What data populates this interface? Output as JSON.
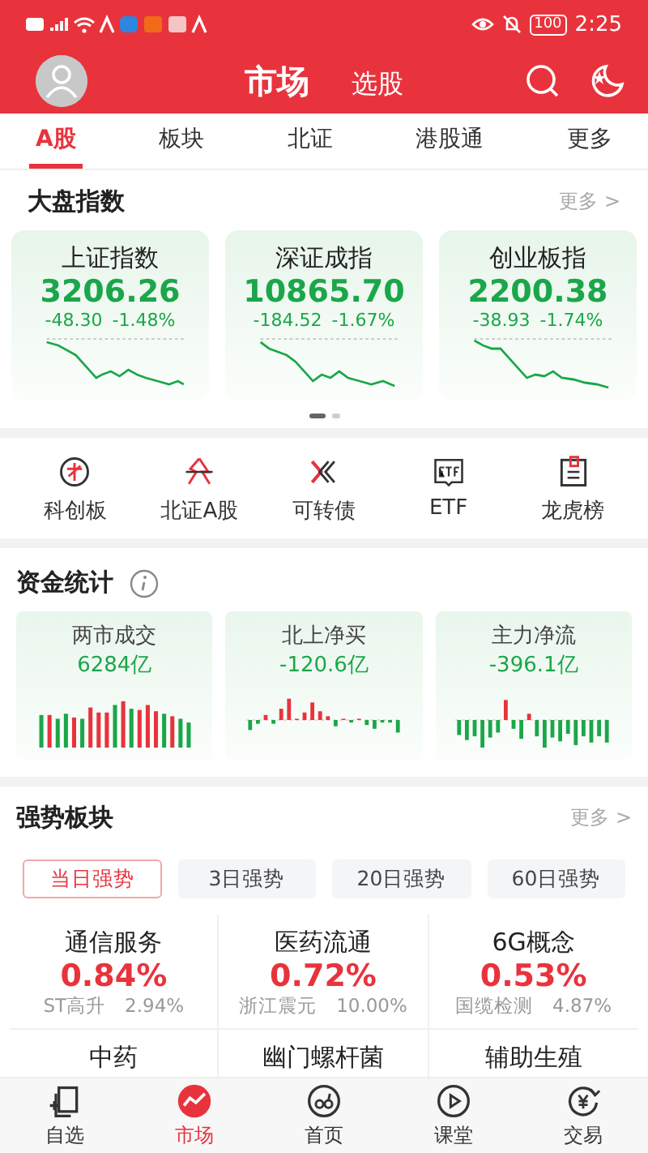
{
  "status_bar": {
    "battery": "100",
    "time": "2:25"
  },
  "header": {
    "title": "市场",
    "secondary": "选股"
  },
  "tabs": [
    {
      "label": "A股",
      "selected": true
    },
    {
      "label": "板块",
      "selected": false
    },
    {
      "label": "北证",
      "selected": false
    },
    {
      "label": "港股通",
      "selected": false
    },
    {
      "label": "更多",
      "selected": false
    }
  ],
  "indices": {
    "title": "大盘指数",
    "more": "更多 >",
    "cards": [
      {
        "name": "上证指数",
        "value": "3206.26",
        "change": "-48.30",
        "pct": "-1.48%"
      },
      {
        "name": "深证成指",
        "value": "10865.70",
        "change": "-184.52",
        "pct": "-1.67%"
      },
      {
        "name": "创业板指",
        "value": "2200.38",
        "change": "-38.93",
        "pct": "-1.74%"
      }
    ],
    "pages": [
      {
        "selected": true
      },
      {
        "selected": false
      }
    ]
  },
  "shortcuts": [
    {
      "label": "科创板",
      "kind": "ke"
    },
    {
      "label": "北证A股",
      "kind": "bei"
    },
    {
      "label": "可转债",
      "kind": "bond"
    },
    {
      "label": "ETF",
      "kind": "etf"
    },
    {
      "label": "龙虎榜",
      "kind": "board"
    }
  ],
  "funds": {
    "title": "资金统计",
    "cards": [
      {
        "name": "两市成交",
        "value": "6284亿",
        "kind": "volume"
      },
      {
        "name": "北上净买",
        "value": "-120.6亿",
        "kind": "north"
      },
      {
        "name": "主力净流",
        "value": "-396.1亿",
        "kind": "main"
      }
    ]
  },
  "strong": {
    "title": "强势板块",
    "more": "更多 >",
    "periods": [
      {
        "label": "当日强势",
        "selected": true
      },
      {
        "label": "3日强势",
        "selected": false
      },
      {
        "label": "20日强势",
        "selected": false
      },
      {
        "label": "60日强势",
        "selected": false
      }
    ],
    "sectors": [
      {
        "name": "通信服务",
        "pct": "0.84%",
        "leader": "ST高升",
        "leader_pct": "2.94%"
      },
      {
        "name": "医药流通",
        "pct": "0.72%",
        "leader": "浙江震元",
        "leader_pct": "10.00%"
      },
      {
        "name": "6G概念",
        "pct": "0.53%",
        "leader": "国缆检测",
        "leader_pct": "4.87%"
      },
      {
        "name": "中药"
      },
      {
        "name": "幽门螺杆菌"
      },
      {
        "name": "辅助生殖"
      }
    ]
  },
  "nav": [
    {
      "label": "自选",
      "kind": "watch",
      "selected": false
    },
    {
      "label": "市场",
      "kind": "market",
      "selected": true
    },
    {
      "label": "首页",
      "kind": "home",
      "selected": false
    },
    {
      "label": "课堂",
      "kind": "class",
      "selected": false
    },
    {
      "label": "交易",
      "kind": "trade",
      "selected": false
    }
  ]
}
